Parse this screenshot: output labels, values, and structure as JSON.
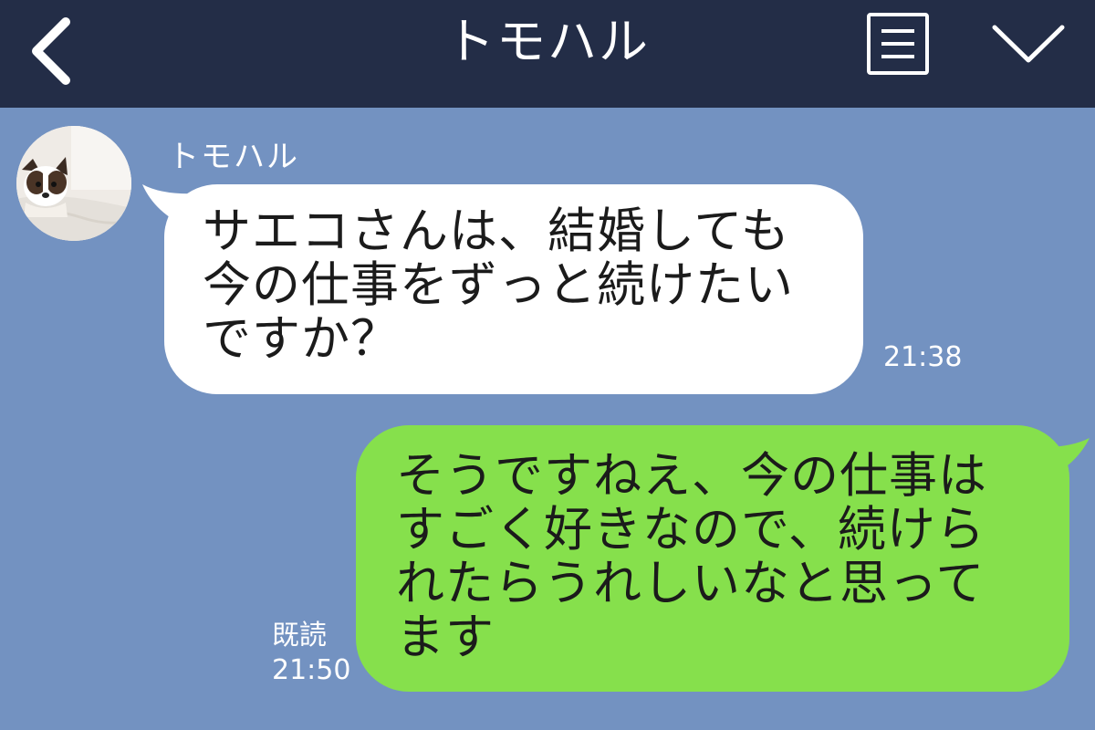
{
  "header": {
    "title": "トモハル",
    "back_icon": "chevron-left-icon",
    "menu_icon": "menu-list-icon",
    "collapse_icon": "chevron-down-icon",
    "background": "#232d47"
  },
  "chat": {
    "background": "#7392c1",
    "messages": [
      {
        "direction": "incoming",
        "sender": "トモハル",
        "avatar_icon": "dog-avatar-icon",
        "lines": [
          "サエコさんは、結婚しても",
          "今の仕事をずっと続けたい",
          "ですか？"
        ],
        "time": "21:38",
        "bubble_color": "#ffffff"
      },
      {
        "direction": "outgoing",
        "lines": [
          "そうですねえ、今の仕事は",
          "すごく好きなので、続けら",
          "れたらうれしいなと思って",
          "ます"
        ],
        "read_label": "既読",
        "time": "21:50",
        "bubble_color": "#86e04c"
      }
    ]
  }
}
